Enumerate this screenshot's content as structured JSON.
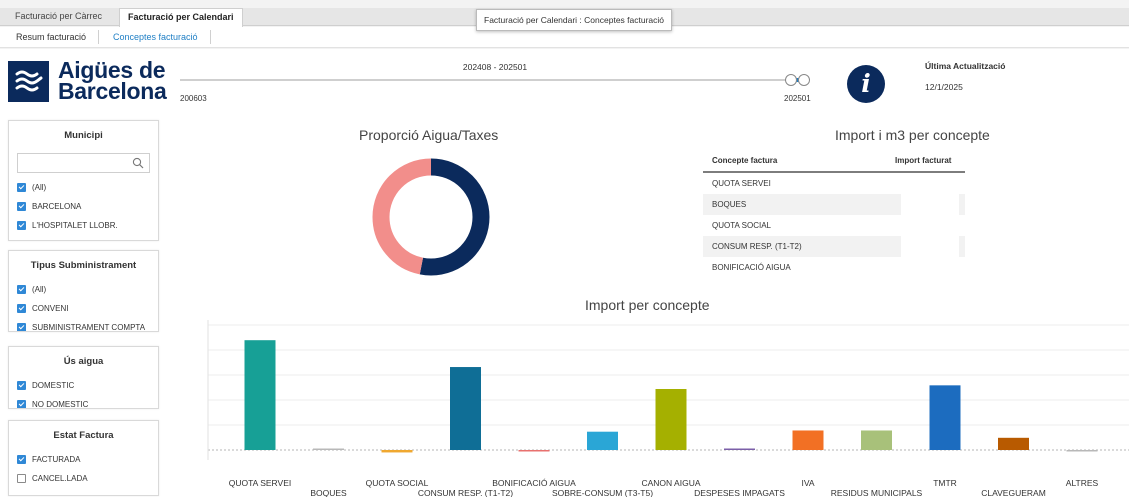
{
  "tabs_level1": [
    {
      "label": "Facturació per Càrrec",
      "active": false
    },
    {
      "label": "Facturació per Calendari",
      "active": true
    }
  ],
  "tooltip": "Facturació per Calendari : Conceptes facturació",
  "tabs_level2": [
    {
      "label": "Resum facturació",
      "active": false
    },
    {
      "label": "Conceptes facturació",
      "active": true
    }
  ],
  "logo": {
    "line1": "Aigües de",
    "line2": "Barcelona"
  },
  "period_slider": {
    "range_label": "202408 - 202501",
    "min_label": "200603",
    "max_label": "202501"
  },
  "info_icon": "i",
  "last_update": {
    "title": "Última Actualització",
    "date": "12/1/2025"
  },
  "filters": [
    {
      "title": "Municipi",
      "search": true,
      "options": [
        {
          "label": "(All)",
          "checked": true
        },
        {
          "label": "BARCELONA",
          "checked": true
        },
        {
          "label": "L'HOSPITALET LLOBR.",
          "checked": true
        }
      ]
    },
    {
      "title": "Tipus Subministrament",
      "search": false,
      "options": [
        {
          "label": "(All)",
          "checked": true
        },
        {
          "label": "CONVENI",
          "checked": true
        },
        {
          "label": "SUBMINISTRAMENT COMPTA",
          "checked": true
        }
      ]
    },
    {
      "title": "Ús aigua",
      "search": false,
      "options": [
        {
          "label": "DOMESTIC",
          "checked": true
        },
        {
          "label": "NO DOMESTIC",
          "checked": true
        }
      ]
    },
    {
      "title": "Estat Factura",
      "search": false,
      "options": [
        {
          "label": "FACTURADA",
          "checked": true
        },
        {
          "label": "CANCEL.LADA",
          "checked": false
        }
      ]
    }
  ],
  "donut": {
    "title": "Proporció Aigua/Taxes",
    "segments": [
      {
        "share": 0.53,
        "color": "#0b2a5c"
      },
      {
        "share": 0.47,
        "color": "#f28e8b"
      }
    ]
  },
  "table": {
    "title": "Import i m3 per concepte",
    "headers": [
      "Concepte factura",
      "Import facturat"
    ],
    "rows": [
      "QUOTA SERVEI",
      "BOQUES",
      "QUOTA SOCIAL",
      "CONSUM RESP. (T1-T2)",
      "BONIFICACIÓ AIGUA"
    ]
  },
  "chart_data": {
    "type": "bar",
    "title": "Import per concepte",
    "categories": [
      "QUOTA SERVEI",
      "BOQUES",
      "QUOTA SOCIAL",
      "CONSUM RESP. (T1-T2)",
      "BONIFICACIÓ AIGUA",
      "SOBRE-CONSUM (T3-T5)",
      "CANON AIGUA",
      "DESPESES IMPAGATS",
      "IVA",
      "RESIDUS MUNICIPALS",
      "TMTR",
      "CLAVEGUERAM",
      "ALTRES"
    ],
    "values": [
      45,
      0.3,
      -1,
      34,
      -0.5,
      7.5,
      25,
      0.4,
      8,
      8,
      26.5,
      5,
      -0.3
    ],
    "colors": [
      "#17a096",
      "#b8b8b8",
      "#f0a830",
      "#0f6e96",
      "#e8716f",
      "#2aa6d6",
      "#a5b000",
      "#7b5fa8",
      "#f27024",
      "#a8c17a",
      "#1c6cbf",
      "#b85a00",
      "#b8b8b8"
    ],
    "ylim": [
      -2,
      50
    ],
    "grid": true
  }
}
